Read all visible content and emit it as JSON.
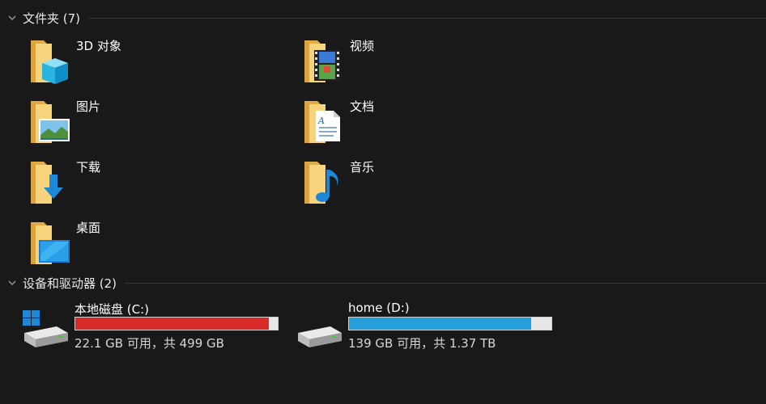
{
  "sections": {
    "folders": {
      "title": "文件夹 (7)"
    },
    "devices": {
      "title": "设备和驱动器 (2)"
    }
  },
  "folders": [
    {
      "label": "3D 对象",
      "icon": "3d-objects-folder-icon"
    },
    {
      "label": "视频",
      "icon": "videos-folder-icon"
    },
    {
      "label": "图片",
      "icon": "pictures-folder-icon"
    },
    {
      "label": "文档",
      "icon": "documents-folder-icon"
    },
    {
      "label": "下载",
      "icon": "downloads-folder-icon"
    },
    {
      "label": "音乐",
      "icon": "music-folder-icon"
    },
    {
      "label": "桌面",
      "icon": "desktop-folder-icon"
    }
  ],
  "drives": [
    {
      "name": "本地磁盘 (C:)",
      "size_text": "22.1 GB 可用，共 499 GB",
      "used_fraction": 0.956,
      "bar_color": "#da2b2b",
      "icon": "windows-drive-icon"
    },
    {
      "name": "home (D:)",
      "size_text": "139 GB 可用，共 1.37 TB",
      "used_fraction": 0.899,
      "bar_color": "#26a0da",
      "icon": "hard-drive-icon"
    }
  ],
  "colors": {
    "background": "#191919",
    "folder_yellow": "#f3c969",
    "accent_blue": "#26a0da"
  }
}
